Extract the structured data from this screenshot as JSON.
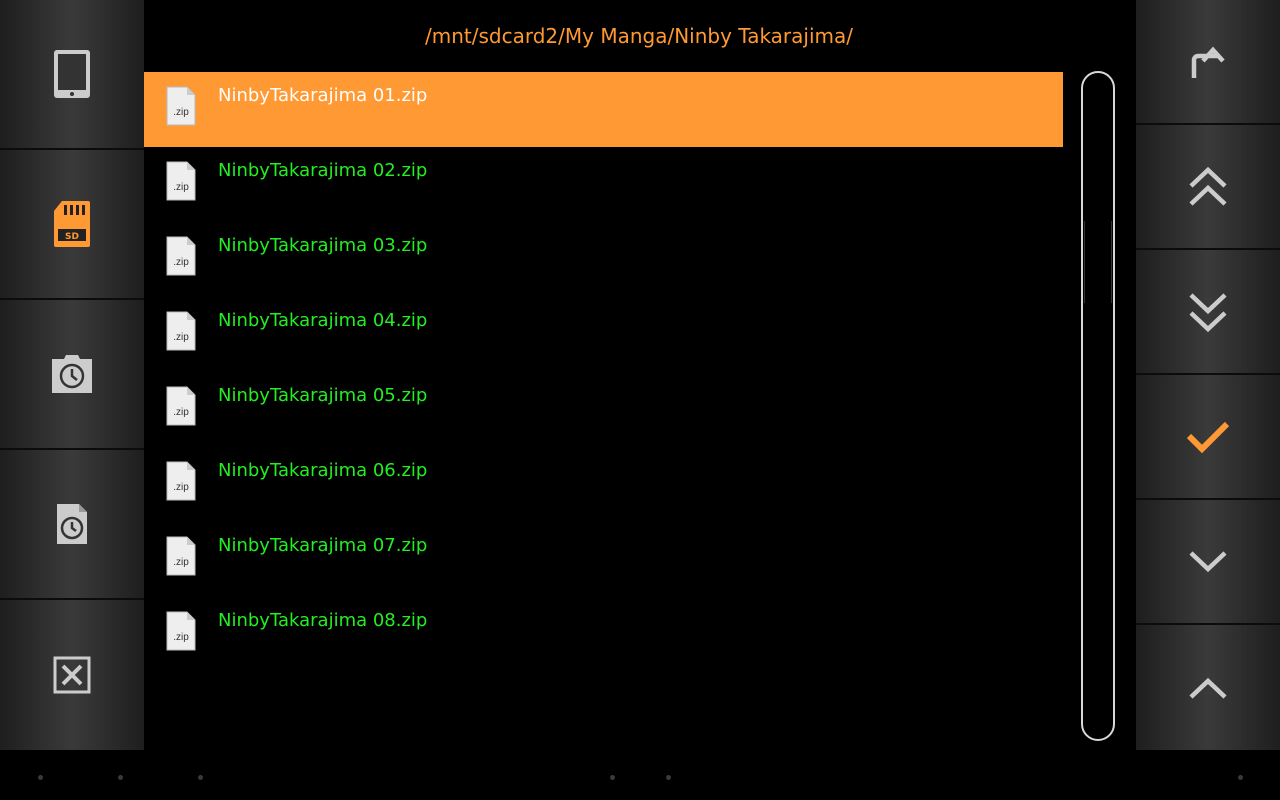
{
  "header": {
    "path": "/mnt/sdcard2/My Manga/Ninby Takarajima/"
  },
  "files": [
    {
      "name": "NinbyTakarajima 01.zip",
      "icon_label": ".zip"
    },
    {
      "name": "NinbyTakarajima 02.zip",
      "icon_label": ".zip"
    },
    {
      "name": "NinbyTakarajima 03.zip",
      "icon_label": ".zip"
    },
    {
      "name": "NinbyTakarajima 04.zip",
      "icon_label": ".zip"
    },
    {
      "name": "NinbyTakarajima 05.zip",
      "icon_label": ".zip"
    },
    {
      "name": "NinbyTakarajima 06.zip",
      "icon_label": ".zip"
    },
    {
      "name": "NinbyTakarajima 07.zip",
      "icon_label": ".zip"
    },
    {
      "name": "NinbyTakarajima 08.zip",
      "icon_label": ".zip"
    }
  ],
  "selected_index": 0,
  "left_sidebar": [
    {
      "icon": "tablet-icon"
    },
    {
      "icon": "sd-card-icon",
      "label": "SD"
    },
    {
      "icon": "history-folder-icon"
    },
    {
      "icon": "recent-file-icon"
    },
    {
      "icon": "close-box-icon"
    }
  ],
  "right_sidebar": [
    {
      "icon": "folder-up-icon"
    },
    {
      "icon": "double-chevron-up-icon"
    },
    {
      "icon": "double-chevron-down-icon"
    },
    {
      "icon": "checkmark-icon"
    },
    {
      "icon": "chevron-down-icon"
    },
    {
      "icon": "chevron-up-icon"
    }
  ],
  "colors": {
    "accent": "#ff9933",
    "file_text": "#22ee22",
    "selected_text": "#ffffff",
    "icon_gray": "#cccccc"
  }
}
